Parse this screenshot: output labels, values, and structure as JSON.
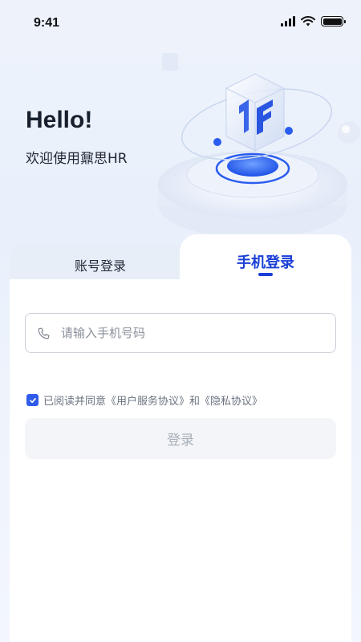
{
  "status_bar": {
    "time": "9:41"
  },
  "hero": {
    "title": "Hello!",
    "subtitle": "欢迎使用鼐思HR"
  },
  "tabs": [
    {
      "label": "账号登录",
      "active": false
    },
    {
      "label": "手机登录",
      "active": true
    }
  ],
  "phone_input": {
    "placeholder": "请输入手机号码",
    "value": ""
  },
  "agreement": {
    "checked": true,
    "text": "已阅读并同意《用户服务协议》和《隐私协议》"
  },
  "login_button": {
    "label": "登录"
  },
  "colors": {
    "accent": "#1a3fd6",
    "checkbox": "#2f5bea",
    "button_bg": "#f3f5f8"
  }
}
